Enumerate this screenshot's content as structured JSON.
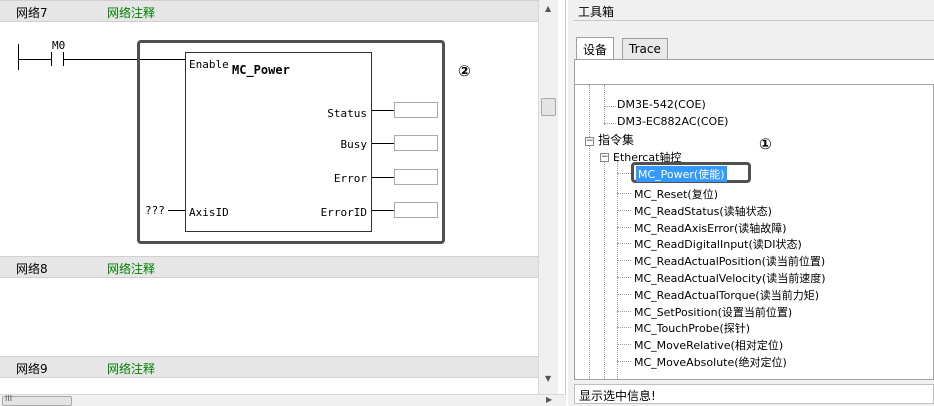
{
  "editor": {
    "networks": [
      {
        "label": "网络7",
        "comment": "网络注释"
      },
      {
        "label": "网络8",
        "comment": "网络注释"
      },
      {
        "label": "网络9",
        "comment": "网络注释"
      }
    ],
    "contact_name": "M0",
    "function_block": {
      "name": "MC_Power",
      "input_enable": "Enable",
      "input_axis": "AxisID",
      "axis_value": "???",
      "outputs": [
        "Status",
        "Busy",
        "Error",
        "ErrorID"
      ]
    },
    "callout_2": "②"
  },
  "toolbox": {
    "title": "工具箱",
    "tabs": [
      "设备",
      "Trace"
    ],
    "callout_1": "①",
    "tree": {
      "devices": [
        "DM3E-542(COE)",
        "DM3-EC882AC(COE)"
      ],
      "category": "指令集",
      "subcategory": "Ethercat轴控",
      "selected": "MC_Power(使能)",
      "items": [
        "MC_Reset(复位)",
        "MC_ReadStatus(读轴状态)",
        "MC_ReadAxisError(读轴故障)",
        "MC_ReadDigitalInput(读DI状态)",
        "MC_ReadActualPosition(读当前位置)",
        "MC_ReadActualVelocity(读当前速度)",
        "MC_ReadActualTorque(读当前力矩)",
        "MC_SetPosition(设置当前位置)",
        "MC_TouchProbe(探针)",
        "MC_MoveRelative(相对定位)",
        "MC_MoveAbsolute(绝对定位)"
      ]
    },
    "status_text": "显示选中信息!"
  },
  "scrollbar": {
    "hscroll_label": "III"
  },
  "colors": {
    "comment_green": "#008000",
    "selection": "#3399ff",
    "header_bg": "#e6e6e6"
  }
}
